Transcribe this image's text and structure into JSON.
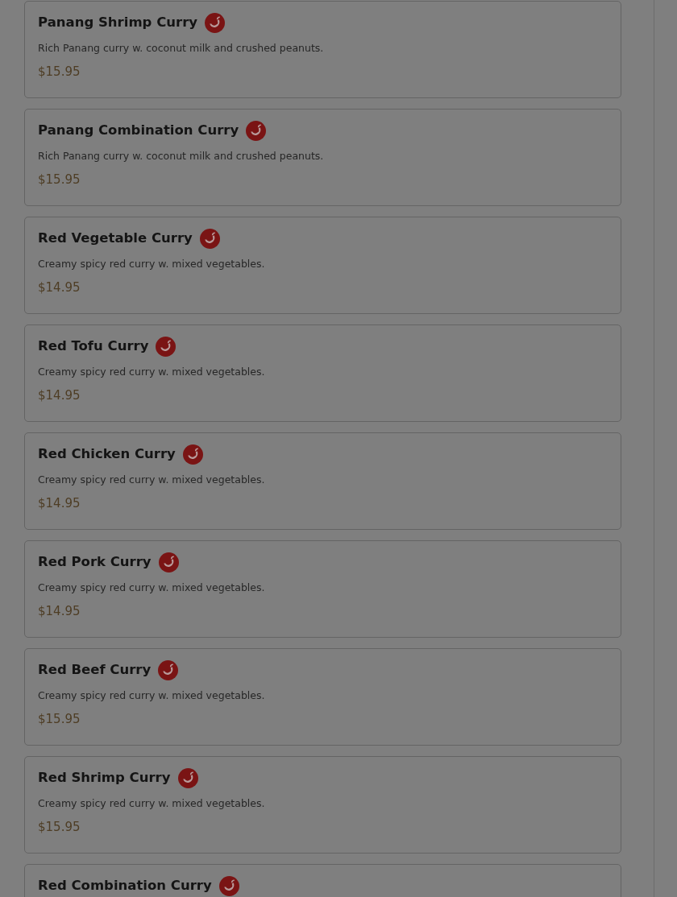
{
  "menu_items": [
    {
      "name": "Panang Shrimp Curry",
      "spicy": true,
      "description": "Rich Panang curry w. coconut milk and crushed peanuts.",
      "price": "$15.95"
    },
    {
      "name": "Panang Combination Curry",
      "spicy": true,
      "description": "Rich Panang curry w. coconut milk and crushed peanuts.",
      "price": "$15.95"
    },
    {
      "name": "Red Vegetable Curry",
      "spicy": true,
      "description": "Creamy spicy red curry w. mixed vegetables.",
      "price": "$14.95"
    },
    {
      "name": "Red Tofu Curry",
      "spicy": true,
      "description": "Creamy spicy red curry w. mixed vegetables.",
      "price": "$14.95"
    },
    {
      "name": "Red Chicken Curry",
      "spicy": true,
      "description": "Creamy spicy red curry w. mixed vegetables.",
      "price": "$14.95"
    },
    {
      "name": "Red Pork Curry",
      "spicy": true,
      "description": "Creamy spicy red curry w. mixed vegetables.",
      "price": "$14.95"
    },
    {
      "name": "Red Beef Curry",
      "spicy": true,
      "description": "Creamy spicy red curry w. mixed vegetables.",
      "price": "$15.95"
    },
    {
      "name": "Red Shrimp Curry",
      "spicy": true,
      "description": "Creamy spicy red curry w. mixed vegetables.",
      "price": "$15.95"
    },
    {
      "name": "Red Combination Curry",
      "spicy": true
    }
  ]
}
